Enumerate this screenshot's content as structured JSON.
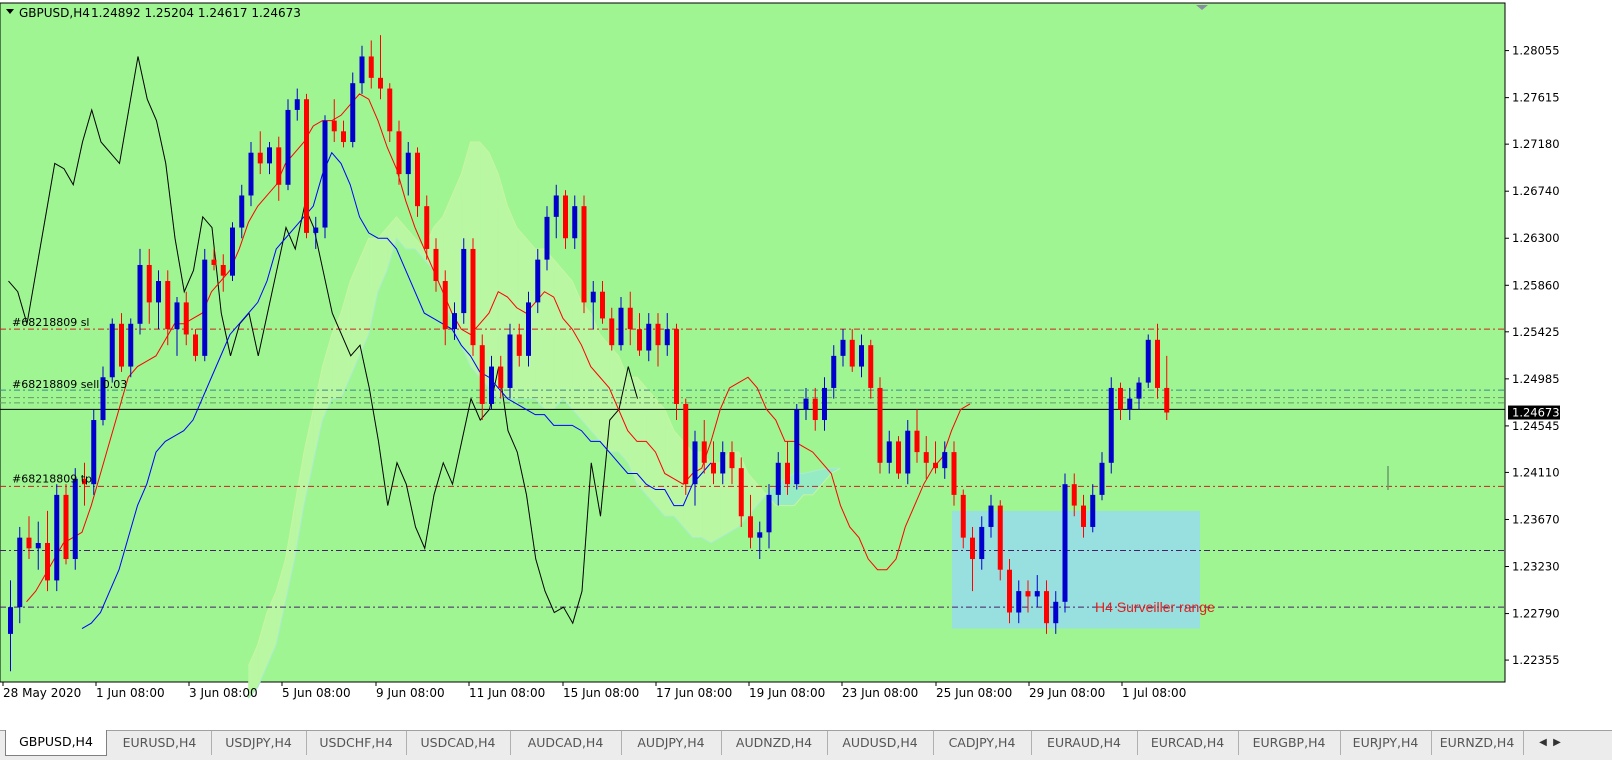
{
  "chart_header": {
    "symbol": "GBPUSD,H4",
    "ohlc": "1.24892 1.25204 1.24617 1.24673"
  },
  "current_price_label": "1.24673",
  "price_axis_labels": [
    "1.28055",
    "1.27615",
    "1.27180",
    "1.26740",
    "1.26300",
    "1.25860",
    "1.25425",
    "1.24985",
    "1.24545",
    "1.24110",
    "1.23670",
    "1.23230",
    "1.22790",
    "1.22355"
  ],
  "time_axis_labels": [
    "28 May 2020",
    "1 Jun 08:00",
    "3 Jun 08:00",
    "5 Jun 08:00",
    "9 Jun 08:00",
    "11 Jun 08:00",
    "15 Jun 08:00",
    "17 Jun 08:00",
    "19 Jun 08:00",
    "23 Jun 08:00",
    "25 Jun 08:00",
    "29 Jun 08:00",
    "1 Jul 08:00"
  ],
  "order_lines": {
    "sl_label": "#68218809 sl",
    "sell_label": "#68218809 sell 0.03",
    "tp_label": "#68218809 tp"
  },
  "range_label": "H4 Surveiller range",
  "tabs": [
    "GBPUSD,H4",
    "EURUSD,H4",
    "USDJPY,H4",
    "USDCHF,H4",
    "USDCAD,H4",
    "AUDCAD,H4",
    "AUDJPY,H4",
    "AUDNZD,H4",
    "AUDUSD,H4",
    "CADJPY,H4",
    "EURAUD,H4",
    "EURCAD,H4",
    "EURGBP,H4",
    "EURJPY,H4",
    "EURNZD,H4"
  ],
  "active_tab": "GBPUSD,H4",
  "colors": {
    "background": "#9ef592",
    "bull_candle": "#0000cc",
    "bear_candle": "#ff0000",
    "tenkan": "#ff0000",
    "kijun": "#0000ff",
    "chikou": "#000000",
    "kumo_bull": "#b9f7a2",
    "kumo_bear": "#95ebc4",
    "range_box": "#98e0e0"
  },
  "chart_data": {
    "type": "candlestick",
    "symbol": "GBPUSD",
    "timeframe": "H4",
    "ylim": [
      1.2215,
      1.285
    ],
    "candles": [
      [
        1.226,
        1.231,
        1.2225,
        1.2285
      ],
      [
        1.2285,
        1.236,
        1.227,
        1.235
      ],
      [
        1.235,
        1.237,
        1.233,
        1.234
      ],
      [
        1.234,
        1.2365,
        1.232,
        1.2345
      ],
      [
        1.2345,
        1.2375,
        1.23,
        1.231
      ],
      [
        1.231,
        1.24,
        1.23,
        1.239
      ],
      [
        1.239,
        1.24,
        1.2325,
        1.233
      ],
      [
        1.233,
        1.2415,
        1.232,
        1.2405
      ],
      [
        1.2405,
        1.242,
        1.238,
        1.24
      ],
      [
        1.24,
        1.247,
        1.239,
        1.246
      ],
      [
        1.246,
        1.251,
        1.2455,
        1.25
      ],
      [
        1.25,
        1.2555,
        1.2495,
        1.255
      ],
      [
        1.255,
        1.256,
        1.2505,
        1.251
      ],
      [
        1.251,
        1.2555,
        1.25,
        1.255
      ],
      [
        1.255,
        1.262,
        1.254,
        1.2605
      ],
      [
        1.2605,
        1.262,
        1.255,
        1.257
      ],
      [
        1.257,
        1.26,
        1.2545,
        1.259
      ],
      [
        1.259,
        1.26,
        1.253,
        1.2545
      ],
      [
        1.2545,
        1.2575,
        1.252,
        1.257
      ],
      [
        1.257,
        1.258,
        1.253,
        1.254
      ],
      [
        1.254,
        1.2545,
        1.2515,
        1.252
      ],
      [
        1.252,
        1.262,
        1.2515,
        1.261
      ],
      [
        1.261,
        1.262,
        1.26,
        1.2605
      ],
      [
        1.2605,
        1.2615,
        1.258,
        1.2595
      ],
      [
        1.2595,
        1.2645,
        1.259,
        1.264
      ],
      [
        1.264,
        1.268,
        1.263,
        1.267
      ],
      [
        1.267,
        1.272,
        1.266,
        1.271
      ],
      [
        1.271,
        1.273,
        1.269,
        1.27
      ],
      [
        1.27,
        1.272,
        1.269,
        1.2715
      ],
      [
        1.2715,
        1.2725,
        1.2665,
        1.268
      ],
      [
        1.268,
        1.276,
        1.2675,
        1.275
      ],
      [
        1.275,
        1.277,
        1.274,
        1.276
      ],
      [
        1.276,
        1.2765,
        1.263,
        1.2635
      ],
      [
        1.2635,
        1.265,
        1.262,
        1.264
      ],
      [
        1.264,
        1.2745,
        1.263,
        1.274
      ],
      [
        1.274,
        1.276,
        1.272,
        1.273
      ],
      [
        1.273,
        1.274,
        1.2715,
        1.272
      ],
      [
        1.272,
        1.2785,
        1.2715,
        1.2775
      ],
      [
        1.2775,
        1.281,
        1.2765,
        1.28
      ],
      [
        1.28,
        1.2815,
        1.277,
        1.278
      ],
      [
        1.278,
        1.282,
        1.276,
        1.277
      ],
      [
        1.277,
        1.2775,
        1.272,
        1.273
      ],
      [
        1.273,
        1.274,
        1.268,
        1.269
      ],
      [
        1.269,
        1.272,
        1.267,
        1.271
      ],
      [
        1.271,
        1.2715,
        1.265,
        1.266
      ],
      [
        1.266,
        1.267,
        1.261,
        1.262
      ],
      [
        1.262,
        1.263,
        1.258,
        1.259
      ],
      [
        1.259,
        1.26,
        1.253,
        1.2545
      ],
      [
        1.2545,
        1.257,
        1.2535,
        1.256
      ],
      [
        1.256,
        1.263,
        1.255,
        1.262
      ],
      [
        1.262,
        1.263,
        1.252,
        1.253
      ],
      [
        1.253,
        1.254,
        1.246,
        1.2475
      ],
      [
        1.2475,
        1.252,
        1.247,
        1.251
      ],
      [
        1.251,
        1.252,
        1.248,
        1.249
      ],
      [
        1.249,
        1.255,
        1.248,
        1.254
      ],
      [
        1.254,
        1.255,
        1.251,
        1.252
      ],
      [
        1.252,
        1.258,
        1.251,
        1.257
      ],
      [
        1.257,
        1.262,
        1.256,
        1.261
      ],
      [
        1.261,
        1.266,
        1.26,
        1.265
      ],
      [
        1.265,
        1.268,
        1.263,
        1.267
      ],
      [
        1.267,
        1.2675,
        1.262,
        1.263
      ],
      [
        1.263,
        1.267,
        1.262,
        1.266
      ],
      [
        1.266,
        1.267,
        1.256,
        1.257
      ],
      [
        1.257,
        1.259,
        1.2545,
        1.258
      ],
      [
        1.258,
        1.259,
        1.255,
        1.2555
      ],
      [
        1.2555,
        1.2565,
        1.2525,
        1.253
      ],
      [
        1.253,
        1.2575,
        1.2525,
        1.2565
      ],
      [
        1.2565,
        1.258,
        1.253,
        1.2545
      ],
      [
        1.2545,
        1.256,
        1.252,
        1.2525
      ],
      [
        1.2525,
        1.256,
        1.2515,
        1.255
      ],
      [
        1.255,
        1.256,
        1.251,
        1.253
      ],
      [
        1.253,
        1.256,
        1.252,
        1.2545
      ],
      [
        1.2545,
        1.255,
        1.246,
        1.2475
      ],
      [
        1.2475,
        1.248,
        1.239,
        1.24
      ],
      [
        1.24,
        1.245,
        1.238,
        1.244
      ],
      [
        1.244,
        1.246,
        1.241,
        1.242
      ],
      [
        1.242,
        1.244,
        1.24,
        1.241
      ],
      [
        1.241,
        1.244,
        1.24,
        1.243
      ],
      [
        1.243,
        1.244,
        1.24,
        1.2415
      ],
      [
        1.2415,
        1.2425,
        1.236,
        1.237
      ],
      [
        1.237,
        1.239,
        1.234,
        1.235
      ],
      [
        1.235,
        1.2365,
        1.233,
        1.2355
      ],
      [
        1.2355,
        1.24,
        1.234,
        1.239
      ],
      [
        1.239,
        1.243,
        1.238,
        1.242
      ],
      [
        1.242,
        1.244,
        1.239,
        1.24
      ],
      [
        1.24,
        1.2475,
        1.2395,
        1.247
      ],
      [
        1.247,
        1.249,
        1.246,
        1.248
      ],
      [
        1.248,
        1.249,
        1.245,
        1.246
      ],
      [
        1.246,
        1.25,
        1.245,
        1.249
      ],
      [
        1.249,
        1.253,
        1.248,
        1.252
      ],
      [
        1.252,
        1.2545,
        1.251,
        1.2535
      ],
      [
        1.2535,
        1.2545,
        1.2505,
        1.251
      ],
      [
        1.251,
        1.254,
        1.25,
        1.253
      ],
      [
        1.253,
        1.2535,
        1.248,
        1.249
      ],
      [
        1.249,
        1.25,
        1.241,
        1.242
      ],
      [
        1.242,
        1.245,
        1.241,
        1.244
      ],
      [
        1.244,
        1.2445,
        1.2405,
        1.241
      ],
      [
        1.241,
        1.246,
        1.24,
        1.245
      ],
      [
        1.245,
        1.247,
        1.242,
        1.243
      ],
      [
        1.243,
        1.2445,
        1.2405,
        1.242
      ],
      [
        1.242,
        1.244,
        1.241,
        1.2415
      ],
      [
        1.2415,
        1.244,
        1.2405,
        1.243
      ],
      [
        1.243,
        1.244,
        1.238,
        1.239
      ],
      [
        1.239,
        1.2395,
        1.234,
        1.235
      ],
      [
        1.235,
        1.236,
        1.23,
        1.233
      ],
      [
        1.233,
        1.237,
        1.232,
        1.236
      ],
      [
        1.236,
        1.239,
        1.235,
        1.238
      ],
      [
        1.238,
        1.2385,
        1.231,
        1.232
      ],
      [
        1.232,
        1.233,
        1.227,
        1.228
      ],
      [
        1.228,
        1.231,
        1.227,
        1.23
      ],
      [
        1.23,
        1.231,
        1.228,
        1.2295
      ],
      [
        1.2295,
        1.2315,
        1.2285,
        1.23
      ],
      [
        1.23,
        1.231,
        1.226,
        1.227
      ],
      [
        1.227,
        1.23,
        1.226,
        1.229
      ],
      [
        1.229,
        1.241,
        1.228,
        1.24
      ],
      [
        1.24,
        1.241,
        1.237,
        1.238
      ],
      [
        1.238,
        1.239,
        1.235,
        1.236
      ],
      [
        1.236,
        1.24,
        1.2355,
        1.239
      ],
      [
        1.239,
        1.243,
        1.2385,
        1.242
      ],
      [
        1.242,
        1.25,
        1.241,
        1.249
      ],
      [
        1.249,
        1.2495,
        1.246,
        1.247
      ],
      [
        1.247,
        1.249,
        1.246,
        1.248
      ],
      [
        1.248,
        1.25,
        1.247,
        1.2495
      ],
      [
        1.2495,
        1.254,
        1.249,
        1.2535
      ],
      [
        1.2535,
        1.255,
        1.248,
        1.249
      ],
      [
        1.249,
        1.252,
        1.246,
        1.2467
      ]
    ],
    "tenkan": [
      1.229,
      1.23,
      1.2315,
      1.233,
      1.2345,
      1.235,
      1.2355,
      1.238,
      1.241,
      1.244,
      1.247,
      1.25,
      1.251,
      1.2515,
      1.252,
      1.2535,
      1.255,
      1.255,
      1.2555,
      1.256,
      1.258,
      1.259,
      1.26,
      1.262,
      1.2645,
      1.266,
      1.267,
      1.268,
      1.27,
      1.271,
      1.272,
      1.2735,
      1.274,
      1.274,
      1.2745,
      1.2755,
      1.2765,
      1.276,
      1.274,
      1.2715,
      1.2695,
      1.2665,
      1.264,
      1.262,
      1.26,
      1.258,
      1.256,
      1.2545,
      1.254,
      1.255,
      1.256,
      1.258,
      1.2575,
      1.2565,
      1.256,
      1.257,
      1.258,
      1.2575,
      1.2555,
      1.2545,
      1.253,
      1.251,
      1.25,
      1.249,
      1.247,
      1.245,
      1.244,
      1.244,
      1.243,
      1.241,
      1.2405,
      1.24,
      1.241,
      1.2415,
      1.244,
      1.247,
      1.249,
      1.2495,
      1.25,
      1.249,
      1.247,
      1.246,
      1.244,
      1.244,
      1.2435,
      1.243,
      1.242,
      1.241,
      1.238,
      1.236,
      1.235,
      1.233,
      1.232,
      1.232,
      1.233,
      1.236,
      1.238,
      1.24,
      1.2415,
      1.2425,
      1.245,
      1.247,
      1.2475
    ],
    "kijun": [
      1.2265,
      1.227,
      1.228,
      1.23,
      1.232,
      1.235,
      1.238,
      1.24,
      1.243,
      1.244,
      1.2445,
      1.245,
      1.246,
      1.248,
      1.25,
      1.252,
      1.254,
      1.255,
      1.256,
      1.257,
      1.259,
      1.262,
      1.263,
      1.264,
      1.265,
      1.266,
      1.269,
      1.271,
      1.27,
      1.268,
      1.265,
      1.2635,
      1.263,
      1.263,
      1.262,
      1.26,
      1.258,
      1.256,
      1.2555,
      1.255,
      1.2545,
      1.253,
      1.252,
      1.2505,
      1.25,
      1.249,
      1.248,
      1.2475,
      1.247,
      1.2465,
      1.2465,
      1.2455,
      1.2455,
      1.2455,
      1.245,
      1.244,
      1.244,
      1.243,
      1.242,
      1.241,
      1.241,
      1.24,
      1.2395,
      1.2395,
      1.238,
      1.238,
      1.24,
      1.241,
      1.242
    ],
    "chikou": [
      1.259,
      1.258,
      1.255,
      1.26,
      1.265,
      1.27,
      1.2695,
      1.268,
      1.272,
      1.275,
      1.272,
      1.271,
      1.27,
      1.275,
      1.28,
      1.276,
      1.274,
      1.27,
      1.263,
      1.258,
      1.26,
      1.265,
      1.264,
      1.256,
      1.252,
      1.255,
      1.256,
      1.252,
      1.256,
      1.26,
      1.264,
      1.262,
      1.266,
      1.264,
      1.26,
      1.256,
      1.254,
      1.252,
      1.253,
      1.249,
      1.244,
      1.238,
      1.242,
      1.24,
      1.236,
      1.234,
      1.239,
      1.242,
      1.24,
      1.244,
      1.248,
      1.246,
      1.247,
      1.251,
      1.245,
      1.243,
      1.239,
      1.233,
      1.23,
      1.228,
      1.2285,
      1.227,
      1.23,
      1.242,
      1.237,
      1.246,
      1.247,
      1.251,
      1.248
    ],
    "senkou_a": [
      1.223,
      1.225,
      1.228,
      1.23,
      1.233,
      1.238,
      1.243,
      1.247,
      1.251,
      1.254,
      1.256,
      1.259,
      1.261,
      1.263,
      1.263,
      1.264,
      1.265,
      1.264,
      1.263,
      1.262,
      1.264,
      1.265,
      1.267,
      1.269,
      1.272,
      1.272,
      1.271,
      1.269,
      1.266,
      1.264,
      1.263,
      1.262,
      1.262,
      1.261,
      1.26,
      1.259,
      1.257,
      1.256,
      1.254,
      1.253,
      1.252,
      1.25,
      1.25,
      1.249,
      1.248,
      1.247,
      1.245,
      1.244,
      1.243,
      1.243,
      1.242,
      1.242,
      1.243,
      1.243,
      1.241,
      1.24,
      1.239,
      1.238,
      1.238,
      1.238,
      1.239,
      1.239,
      1.24,
      1.241,
      1.2415
    ],
    "senkou_b": [
      1.22,
      1.221,
      1.223,
      1.225,
      1.229,
      1.233,
      1.238,
      1.242,
      1.246,
      1.248,
      1.248,
      1.25,
      1.252,
      1.254,
      1.258,
      1.26,
      1.263,
      1.262,
      1.262,
      1.261,
      1.26,
      1.258,
      1.255,
      1.253,
      1.251,
      1.25,
      1.249,
      1.248,
      1.248,
      1.248,
      1.248,
      1.248,
      1.247,
      1.247,
      1.248,
      1.247,
      1.246,
      1.245,
      1.244,
      1.243,
      1.243,
      1.242,
      1.24,
      1.239,
      1.238,
      1.237,
      1.237,
      1.236,
      1.235,
      1.235,
      1.2345,
      1.235,
      1.2355,
      1.236,
      1.237,
      1.238,
      1.239,
      1.24,
      1.2405,
      1.241,
      1.241,
      1.2412,
      1.2414,
      1.2415,
      1.2415
    ],
    "order_levels": {
      "sl": 1.2545,
      "sell": 1.2488,
      "tp": 1.2398
    },
    "horizontal_lines": [
      1.2488,
      1.2481,
      1.2476,
      1.247,
      1.2338,
      1.2285
    ],
    "range_box": {
      "price_top": 1.2375,
      "price_bottom": 1.2265
    },
    "grid": false
  }
}
